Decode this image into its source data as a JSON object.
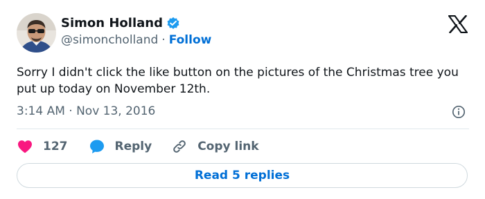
{
  "author": {
    "display_name": "Simon Holland",
    "handle": "@simoncholland",
    "separator": "·",
    "follow_label": "Follow",
    "verified": true
  },
  "tweet": {
    "text": "Sorry I didn't click the like button on the pictures of the Christmas tree you put up today on November 12th.",
    "timestamp": "3:14 AM · Nov 13, 2016"
  },
  "actions": {
    "like_count": "127",
    "reply_label": "Reply",
    "copy_link_label": "Copy link"
  },
  "footer": {
    "read_replies_label": "Read 5 replies"
  },
  "colors": {
    "like": "#f91880",
    "reply": "#1d9bf0",
    "link_blue": "#006fd6",
    "muted": "#536471",
    "verified": "#1d9bf0"
  },
  "icons": {
    "verified": "verified-badge-icon",
    "brand": "x-logo-icon",
    "info": "info-icon",
    "like": "heart-icon",
    "reply": "speech-bubble-icon",
    "copy_link": "link-icon"
  }
}
